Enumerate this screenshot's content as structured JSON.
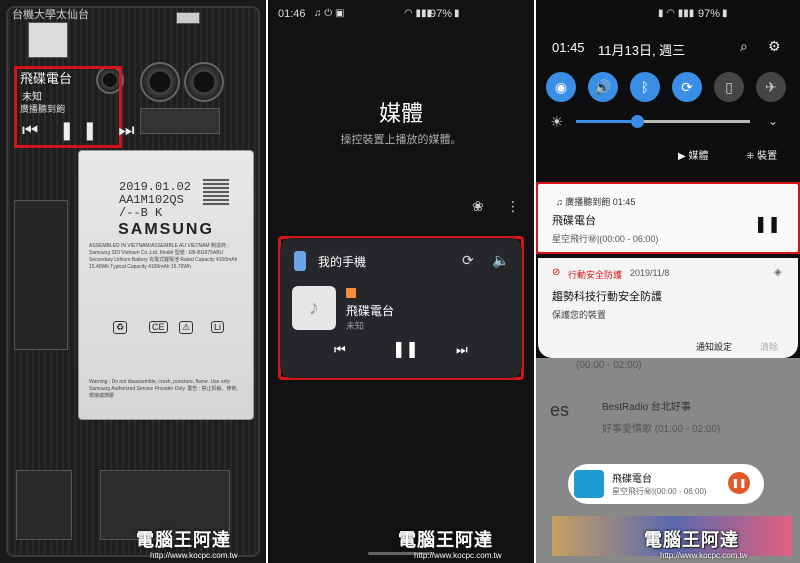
{
  "panel1": {
    "top_text": "台機大學太仙台",
    "overlay": {
      "title": "飛碟電台",
      "subtitle": "未知",
      "subtitle2": "廣播聽到飽",
      "controls": "⏮ ❚❚ ⏭"
    },
    "battery": {
      "date_line1": "2019.01.02",
      "date_line2": "AA1M102QS",
      "date_line3": "/--B K",
      "brand": "SAMSUNG",
      "spec_lines": "ASSEMBLED IN VIETNAM/ASSEMBLE AU VIETNAM 制造商 : Samsung SDI Vietnam Co.,Ltd. Model 型號 : EB-BG975ABU Secondary Lithium Battery 充電式鋰電池 Rated Capacity 4100mAh 15.40Wh Typical Capacity 4100mAh 15.79Wh",
      "warning": "Warning : Do not disassemble, crush, puncture, flame. Use only Samsung Authorized Service Provider Only. 警告 : 禁止拆解、穿刺、燃燒或擠壓"
    }
  },
  "panel2": {
    "status_time": "01:46",
    "status_right": "97%",
    "title": "媒體",
    "subtitle": "操控裝置上播放的媒體。",
    "card": {
      "device": "我的手機",
      "track": "飛碟電台",
      "artist": "未知"
    }
  },
  "panel3": {
    "status_right": "97%",
    "time": "01:45",
    "date": "11月13日, 週三",
    "media_btn": "媒體",
    "devices_btn": "裝置",
    "notif1": {
      "app": "廣播聽到飽",
      "time": "01:45",
      "title": "飛碟電台",
      "subtitle": "星空飛行㊙|(00:00 - 06:00)"
    },
    "notif2": {
      "app": "行動安全防護",
      "date": "2019/11/8",
      "title": "趨勢科技行動安全防護",
      "subtitle": "保護您的裝置",
      "settings": "通知設定",
      "clear": "清除"
    },
    "bg_rows": [
      "(00:00 - 02:00)",
      "BestRadio 台北好事",
      "好事愛情歌 (01:00 - 02:00)"
    ],
    "mini": {
      "title": "飛碟電台",
      "subtitle": "星空飛行㊙|(00:00 - 06:00)"
    }
  },
  "watermark": {
    "text": "電腦王阿達",
    "url": "http://www.kocpc.com.tw"
  },
  "colors": {
    "accent": "#3a8ee6",
    "highlight": "#d4141a",
    "badge": "#ff8a3d"
  }
}
